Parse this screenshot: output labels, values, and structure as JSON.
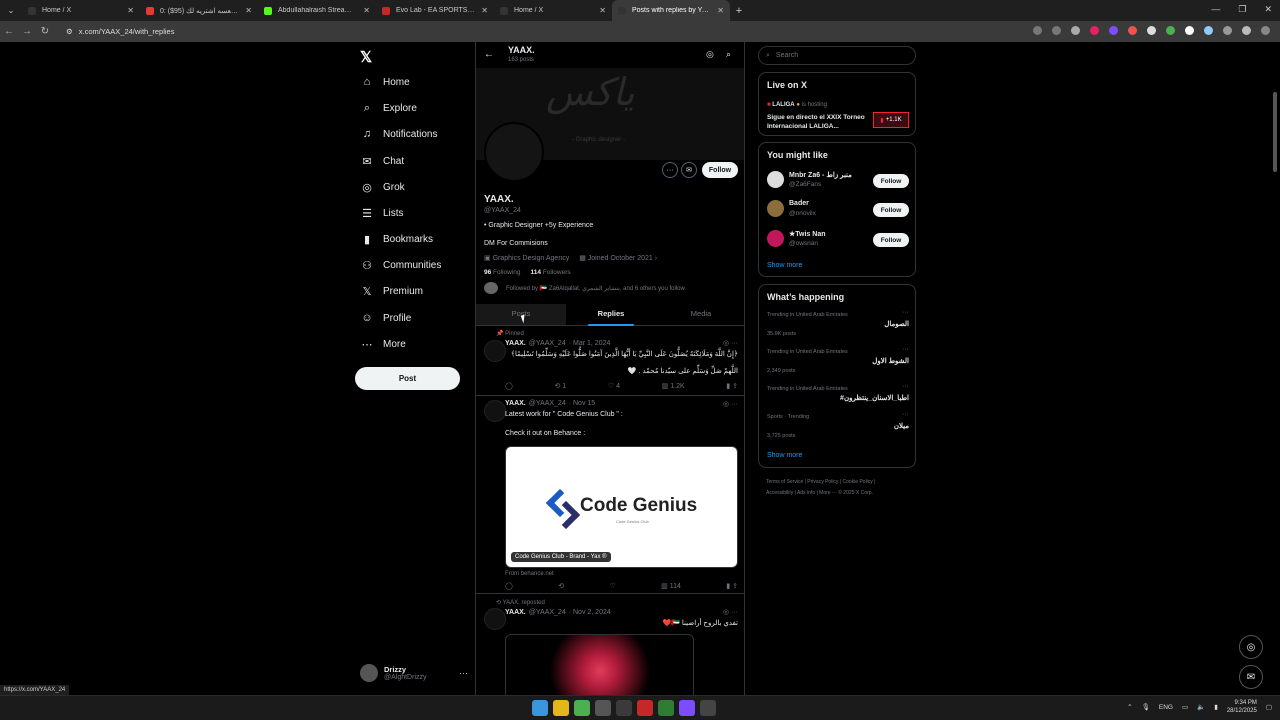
{
  "browser": {
    "tabs": [
      {
        "title": "Home / X",
        "color": "#333"
      },
      {
        "title": "اي شي للعسه اشتريه لك (95$) :0",
        "color": "#e53935"
      },
      {
        "title": "Abdullahalraish Stream - Watch",
        "color": "#53fc18"
      },
      {
        "title": "Evo Lab - EA SPORTS FC 26 - FI",
        "color": "#c62828"
      },
      {
        "title": "Home / X",
        "color": "#333"
      },
      {
        "title": "Posts with replies by YAAX. (@YA",
        "color": "#333"
      }
    ],
    "url": "x.com/YAAX_24/with_replies",
    "status_url": "https://x.com/YAAX_24"
  },
  "nav": {
    "logo": "𝕏",
    "items": [
      {
        "label": "Home",
        "icon": "⌂"
      },
      {
        "label": "Explore",
        "icon": "⌕"
      },
      {
        "label": "Notifications",
        "icon": "♫"
      },
      {
        "label": "Chat",
        "icon": "✉"
      },
      {
        "label": "Grok",
        "icon": "◎"
      },
      {
        "label": "Lists",
        "icon": "☰"
      },
      {
        "label": "Bookmarks",
        "icon": "▮"
      },
      {
        "label": "Communities",
        "icon": "⚇"
      },
      {
        "label": "Premium",
        "icon": "𝕏"
      },
      {
        "label": "Profile",
        "icon": "☺"
      },
      {
        "label": "More",
        "icon": "⋯"
      }
    ],
    "post_button": "Post",
    "account": {
      "name": "Drizzy",
      "handle": "@AlghtDrizzy"
    }
  },
  "profile": {
    "top_name": "YAAX.",
    "top_posts": "163 posts",
    "banner_text": "ياكس",
    "banner_sub": "- Graphic designer -",
    "follow": "Follow",
    "name": "YAAX.",
    "handle": "@YAAX_24",
    "bio1": "• Graphic Designer +5y Experience",
    "bio2": "DM For Commisions",
    "category": "Graphics Design Agency",
    "joined": "Joined October 2021",
    "following_count": "96",
    "following_label": "Following",
    "followers_count": "114",
    "followers_label": "Followers",
    "followed_by": "Followed by 🇦🇪 Za6Alqallat, بنشاير الشمري, and 6 others you follow",
    "tabs": [
      "Posts",
      "Replies",
      "Media"
    ]
  },
  "tweets": [
    {
      "pinned": "Pinned",
      "name": "YAAX.",
      "handle": "@YAAX_24",
      "date": "· Mar 1, 2024",
      "text1": "﴿إِنَّ اللَّهَ وَمَلَائِكَتَهُ يُصَلُّونَ عَلَى النَّبِيِّ يَا أَيُّهَا الَّذِينَ آمَنُوا صَلُّوا عَلَيْهِ وَسَلِّمُوا تَسْلِيمًا﴾",
      "text2": "اللَّهمّ صَلِّ وَسَلِّم على سيّدنا مُحمّد . 🤍",
      "retweets": "1",
      "likes": "4",
      "views": "1.2K"
    },
    {
      "name": "YAAX.",
      "handle": "@YAAX_24",
      "date": "· Nov 15",
      "text1": "Latest work for \" Code Genius Club \" :",
      "text2": "Check it out on Behance :",
      "card_logo": "Code Genius",
      "card_small": "Code Genius Club",
      "card_caption": "Code Genius Club - Brand - Yax ®",
      "from": "From behance.net",
      "views": "114"
    },
    {
      "reposted": "YAAX. reposted",
      "name": "YAAX.",
      "handle": "@YAAX_24",
      "date": "· Nov 2, 2024",
      "text1": "تفدي بالروح أراضينا 🇦🇪❤️"
    }
  ],
  "right": {
    "search_placeholder": "Search",
    "live_title": "Live on X",
    "live_host": "LALIGA",
    "live_hosting": "is hosting",
    "live_text": "Sigue en directo el XXIX Torneo Internacional LALIGA...",
    "live_count": "+1.1K",
    "like_title": "You might like",
    "suggestions": [
      {
        "name": "Mnbr Za6 - منبر زاط",
        "handle": "@Za6Fans"
      },
      {
        "name": "Bader",
        "handle": "@nnovilx"
      },
      {
        "name": "★Twis Nan",
        "handle": "@owsnan"
      }
    ],
    "follow": "Follow",
    "show_more": "Show more",
    "happening_title": "What’s happening",
    "trends": [
      {
        "context": "Trending in United Arab Emirates",
        "topic": "الصومال",
        "posts": "35.9K posts"
      },
      {
        "context": "Trending in United Arab Emirates",
        "topic": "الشوط الاول",
        "posts": "2,349 posts"
      },
      {
        "context": "Trending in United Arab Emirates",
        "topic": "#اطبا_الاسنان_ينتظرون",
        "posts": ""
      },
      {
        "context": "Sports · Trending",
        "topic": "ميلان",
        "posts": "3,725 posts"
      }
    ],
    "footer1": "Terms of Service  |  Privacy Policy  |  Cookie Policy  |",
    "footer2": "Accessibility  |  Ads info  |  More ···  © 2025 X Corp."
  },
  "taskbar": {
    "lang": "ENG",
    "time": "9:34 PM",
    "date": "28/12/2025"
  }
}
